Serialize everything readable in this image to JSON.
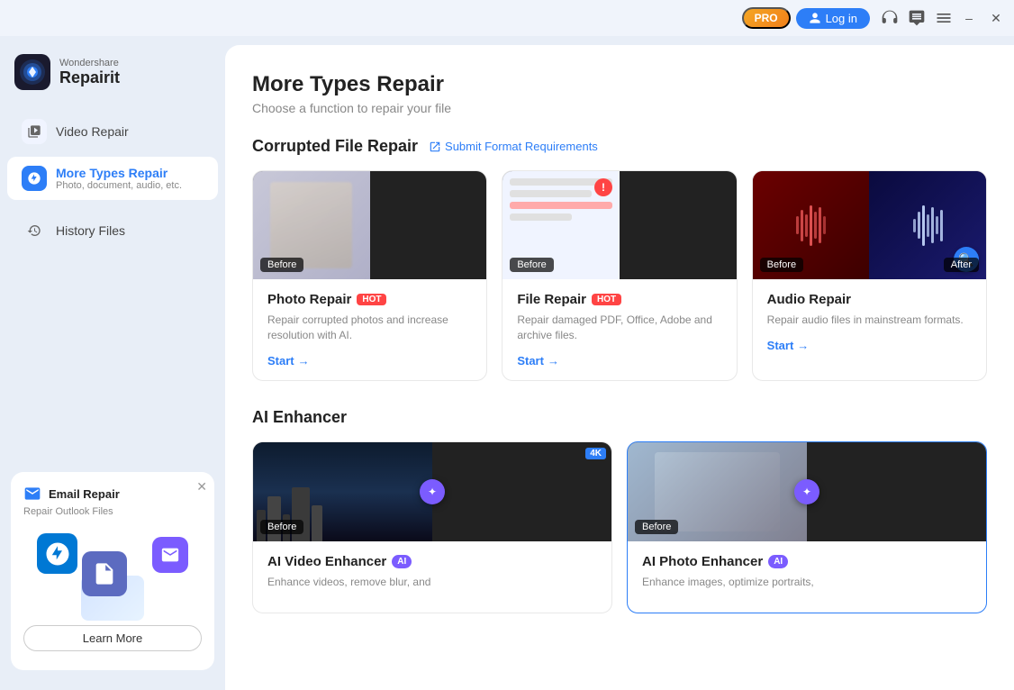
{
  "titleBar": {
    "proBadge": "PRO",
    "loginLabel": "Log in",
    "minimizeTitle": "Minimize",
    "closeTitle": "Close"
  },
  "app": {
    "brand": "Wondershare",
    "name": "Repairit"
  },
  "sidebar": {
    "navItems": [
      {
        "id": "video-repair",
        "label": "Video Repair",
        "icon": "video-icon",
        "active": false
      },
      {
        "id": "more-types-repair",
        "label": "More Types Repair",
        "sub": "Photo, document, audio, etc.",
        "icon": "more-icon",
        "active": true
      }
    ],
    "historyFiles": {
      "label": "History Files",
      "icon": "history-icon"
    },
    "emailCard": {
      "title": "Email Repair",
      "subtitle": "Repair Outlook Files",
      "learnMoreLabel": "Learn More"
    }
  },
  "main": {
    "title": "More Types Repair",
    "subtitle": "Choose a function to repair your file",
    "corruptedFileRepair": {
      "sectionTitle": "Corrupted File Repair",
      "submitLink": "Submit Format Requirements",
      "cards": [
        {
          "id": "photo-repair",
          "title": "Photo Repair",
          "badge": "HOT",
          "badgeType": "hot",
          "desc": "Repair corrupted photos and increase resolution with AI.",
          "startLabel": "Start"
        },
        {
          "id": "file-repair",
          "title": "File Repair",
          "badge": "HOT",
          "badgeType": "hot",
          "desc": "Repair damaged PDF, Office, Adobe and archive files.",
          "startLabel": "Start"
        },
        {
          "id": "audio-repair",
          "title": "Audio Repair",
          "badge": null,
          "badgeType": null,
          "desc": "Repair audio files in mainstream formats.",
          "startLabel": "Start"
        }
      ]
    },
    "aiEnhancer": {
      "sectionTitle": "AI Enhancer",
      "cards": [
        {
          "id": "ai-video-enhancer",
          "title": "AI Video Enhancer",
          "badge": "AI",
          "badgeType": "ai",
          "desc": "Enhance videos, remove blur, and",
          "fourK": "4K"
        },
        {
          "id": "ai-photo-enhancer",
          "title": "AI Photo Enhancer",
          "badge": "AI",
          "badgeType": "ai",
          "desc": "Enhance images, optimize portraits,"
        }
      ]
    }
  }
}
